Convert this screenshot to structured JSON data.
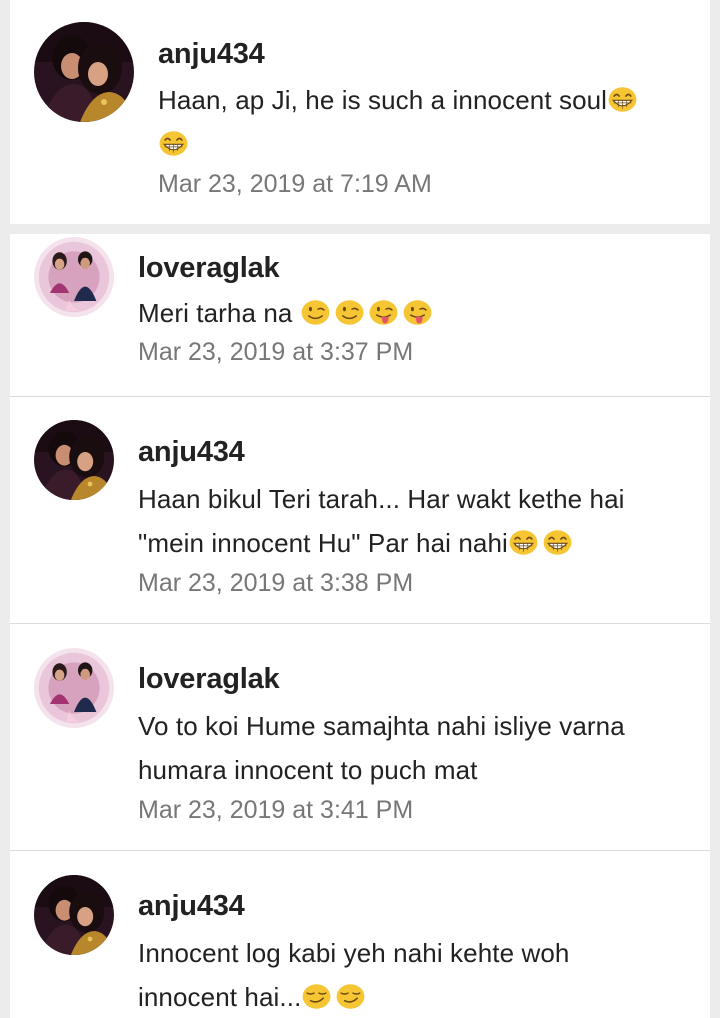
{
  "comments": [
    {
      "username": "anju434",
      "text": "Haan,  ap Ji,  he is such a innocent soul",
      "emojis": [
        "grinning-squint-face",
        "grinning-squint-face"
      ],
      "time": "Mar 23, 2019 at 7:19 AM",
      "avatar": "couple-photo-dark"
    },
    {
      "username": "loveraglak",
      "text": "Meri tarha na ",
      "emojis": [
        "winking-face",
        "winking-face",
        "winking-tongue-face",
        "winking-tongue-face"
      ],
      "time": "Mar 23, 2019 at 3:37 PM",
      "avatar": "couple-photo-pink"
    },
    {
      "username": "anju434",
      "text_line1": "Haan bikul Teri tarah... Har wakt kethe hai",
      "text_line2": "\"mein innocent Hu\" Par hai nahi",
      "emojis": [
        "grinning-squint-face",
        "grinning-squint-face"
      ],
      "time": "Mar 23, 2019 at 3:38 PM",
      "avatar": "couple-photo-dark"
    },
    {
      "username": "loveraglak",
      "text_line1": "Vo to koi Hume samajhta nahi isliye varna",
      "text_line2": "humara innocent to puch mat",
      "time": "Mar 23, 2019 at 3:41 PM",
      "avatar": "couple-photo-pink"
    },
    {
      "username": "anju434",
      "text_line1": "Innocent log kabi yeh nahi kehte woh",
      "text_line2": "innocent hai...",
      "emojis": [
        "smirking-face",
        "smirking-face"
      ],
      "avatar": "couple-photo-dark"
    }
  ],
  "colors": {
    "background": "#ececec",
    "card": "#ffffff",
    "text": "#222222",
    "timestamp": "#777777",
    "emoji": "#f6c533"
  }
}
